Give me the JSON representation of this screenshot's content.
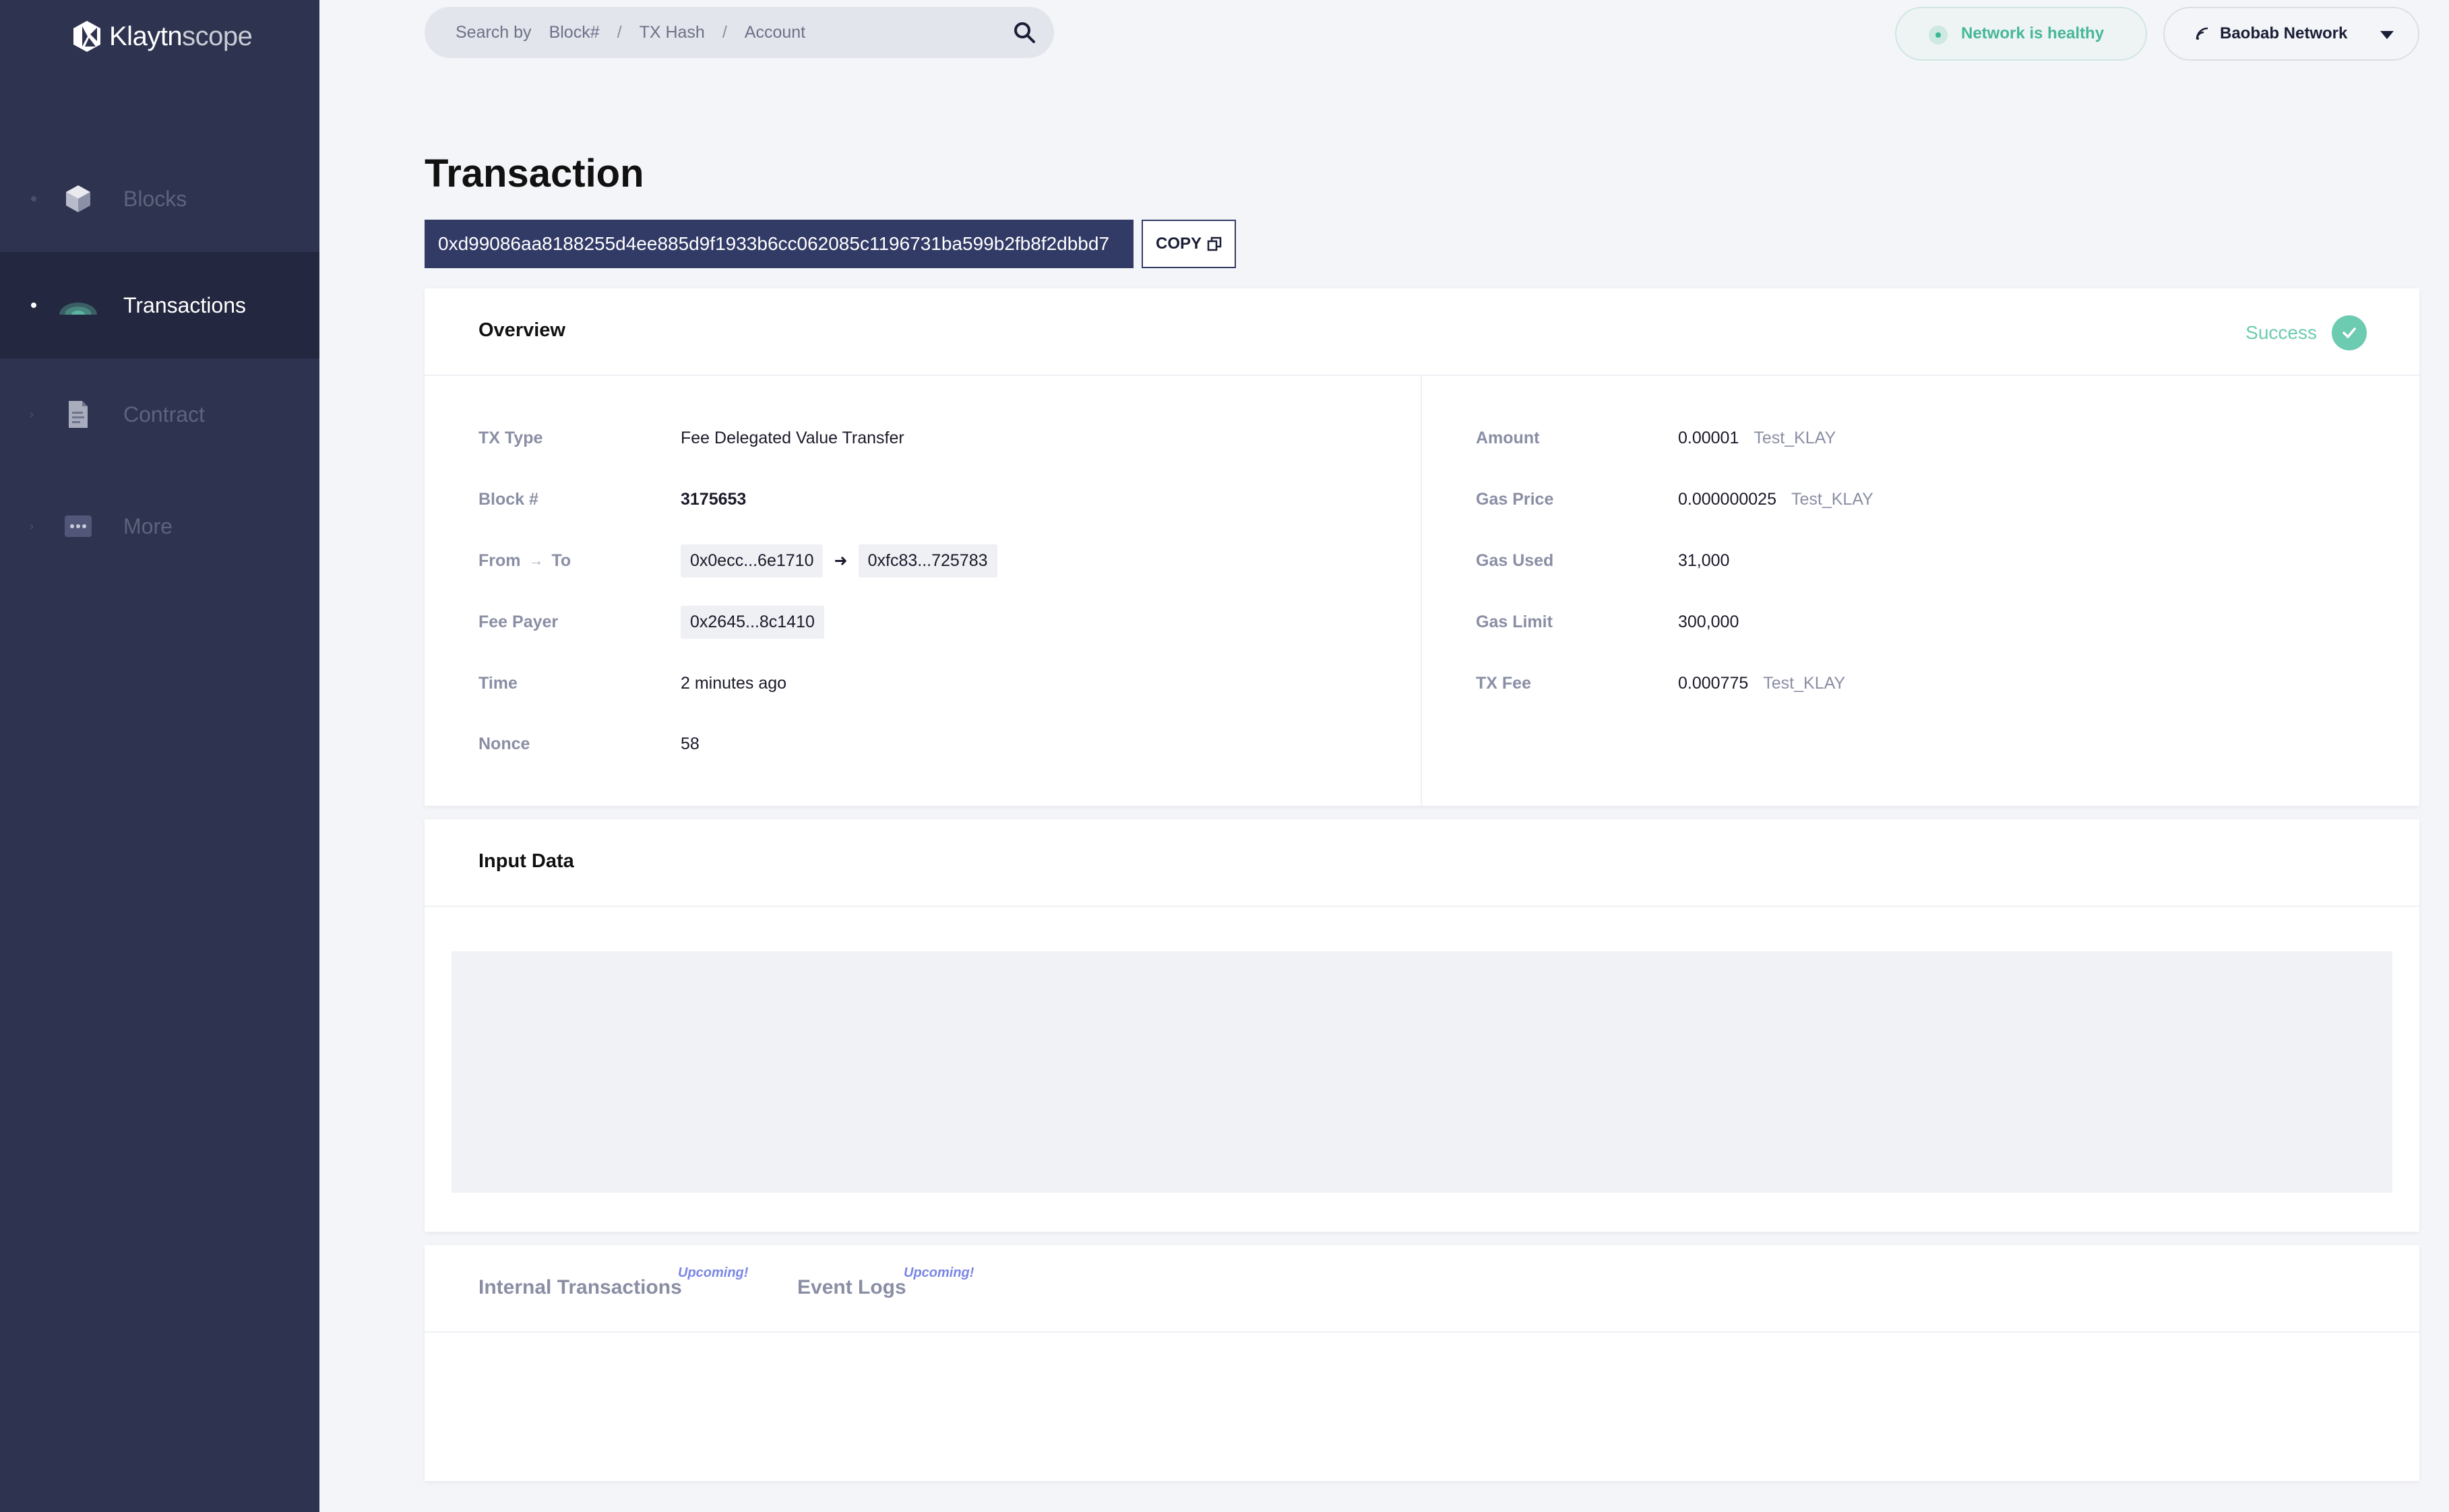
{
  "app": {
    "logo_primary": "Klaytn",
    "logo_secondary": "scope"
  },
  "sidebar": {
    "items": [
      {
        "label": "Blocks",
        "icon": "cube-icon",
        "active": false
      },
      {
        "label": "Transactions",
        "icon": "transactions-icon",
        "active": true
      },
      {
        "label": "Contract",
        "icon": "document-icon",
        "active": false
      },
      {
        "label": "More",
        "icon": "more-icon",
        "active": false
      }
    ]
  },
  "header": {
    "search": {
      "prefix": "Search by",
      "options": [
        "Block#",
        "TX Hash",
        "Account"
      ],
      "separator": "/"
    },
    "health": "Network is healthy",
    "network": "Baobab Network"
  },
  "page": {
    "title": "Transaction",
    "hash": "0xd99086aa8188255d4ee885d9f1933b6cc062085c1196731ba599b2fb8f2dbbd7",
    "copy_label": "COPY"
  },
  "overview": {
    "title": "Overview",
    "status": "Success",
    "left": {
      "tx_type": {
        "label": "TX Type",
        "value": "Fee Delegated Value Transfer"
      },
      "block": {
        "label": "Block #",
        "value": "3175653"
      },
      "from_to": {
        "label_from": "From",
        "label_to": "To",
        "from": "0x0ecc...6e1710",
        "to": "0xfc83...725783"
      },
      "fee_payer": {
        "label": "Fee Payer",
        "value": "0x2645...8c1410"
      },
      "time": {
        "label": "Time",
        "value": "2 minutes ago"
      },
      "nonce": {
        "label": "Nonce",
        "value": "58"
      }
    },
    "right": {
      "amount": {
        "label": "Amount",
        "value": "0.00001",
        "unit": "Test_KLAY"
      },
      "gas_price": {
        "label": "Gas Price",
        "value": "0.000000025",
        "unit": "Test_KLAY"
      },
      "gas_used": {
        "label": "Gas Used",
        "value": "31,000"
      },
      "gas_limit": {
        "label": "Gas Limit",
        "value": "300,000"
      },
      "tx_fee": {
        "label": "TX Fee",
        "value": "0.000775",
        "unit": "Test_KLAY"
      }
    }
  },
  "input_data": {
    "title": "Input Data"
  },
  "tabs": [
    {
      "label": "Internal Transactions",
      "badge": "Upcoming!"
    },
    {
      "label": "Event Logs",
      "badge": "Upcoming!"
    }
  ],
  "colors": {
    "sidebar_bg": "#2e3350",
    "sidebar_active": "#23273f",
    "accent_navy": "#323a66",
    "success": "#6ccbb0",
    "healthy": "#46b79a",
    "upcoming": "#7a86e6"
  }
}
